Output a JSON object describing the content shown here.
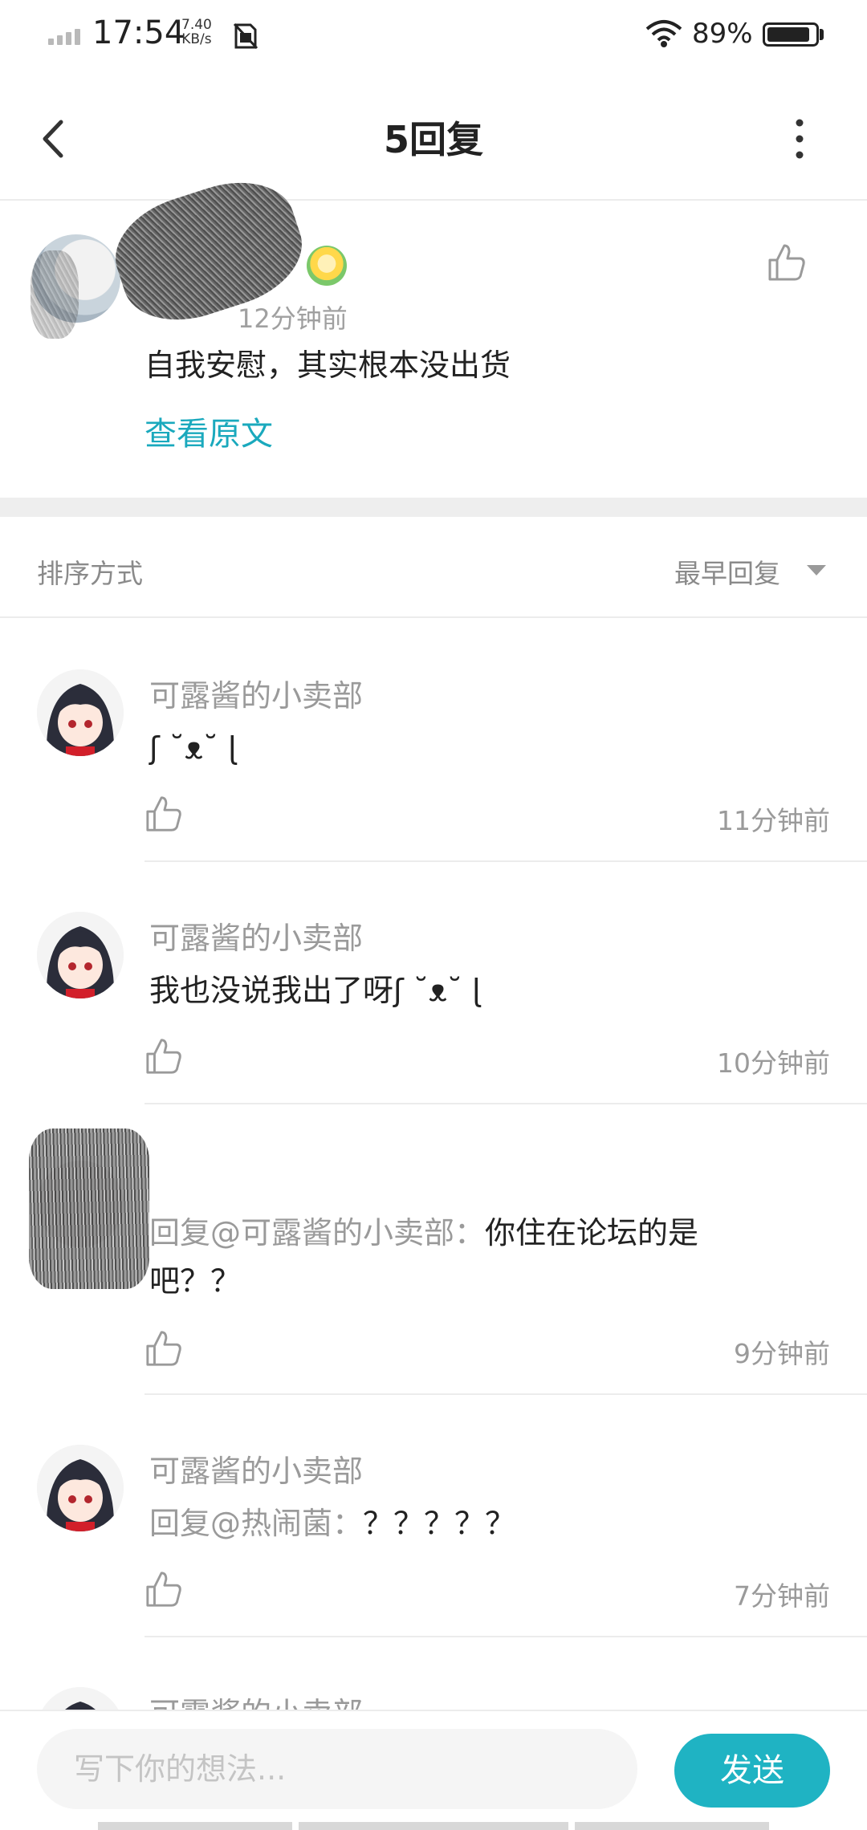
{
  "status_bar": {
    "time": "17:54",
    "net_speed_value": "7.40",
    "net_speed_unit": "KB/s",
    "battery_percent": "89%",
    "battery_level": 0.89
  },
  "header": {
    "title": "5回复"
  },
  "original_comment": {
    "time": "12分钟前",
    "text": "自我安慰，其实根本没出货",
    "view_original_label": "查看原文"
  },
  "sort": {
    "label": "排序方式",
    "value": "最早回复"
  },
  "replies": [
    {
      "author": "可露酱的小卖部",
      "mention": "",
      "text": "ʃ ˘ᴥ˘ ɭ",
      "time": "11分钟前"
    },
    {
      "author": "可露酱的小卖部",
      "mention": "",
      "text": "我也没说我出了呀ʃ ˘ᴥ˘ ɭ",
      "time": "10分钟前"
    },
    {
      "author": "",
      "mention": "回复@可露酱的小卖部：",
      "text": "你住在论坛的是吧？？",
      "time": "9分钟前"
    },
    {
      "author": "可露酱的小卖部",
      "mention": "回复@热闹菌：",
      "text": "？？？？？",
      "time": "7分钟前"
    },
    {
      "author": "可露酱的小卖部",
      "mention": "",
      "text": "",
      "time": ""
    }
  ],
  "composer": {
    "placeholder": "写下你的想法...",
    "send_label": "发送"
  },
  "colors": {
    "accent": "#1fb3c3",
    "link": "#1aa9bd",
    "muted_text": "#9a9a9a",
    "divider": "#ececec"
  }
}
